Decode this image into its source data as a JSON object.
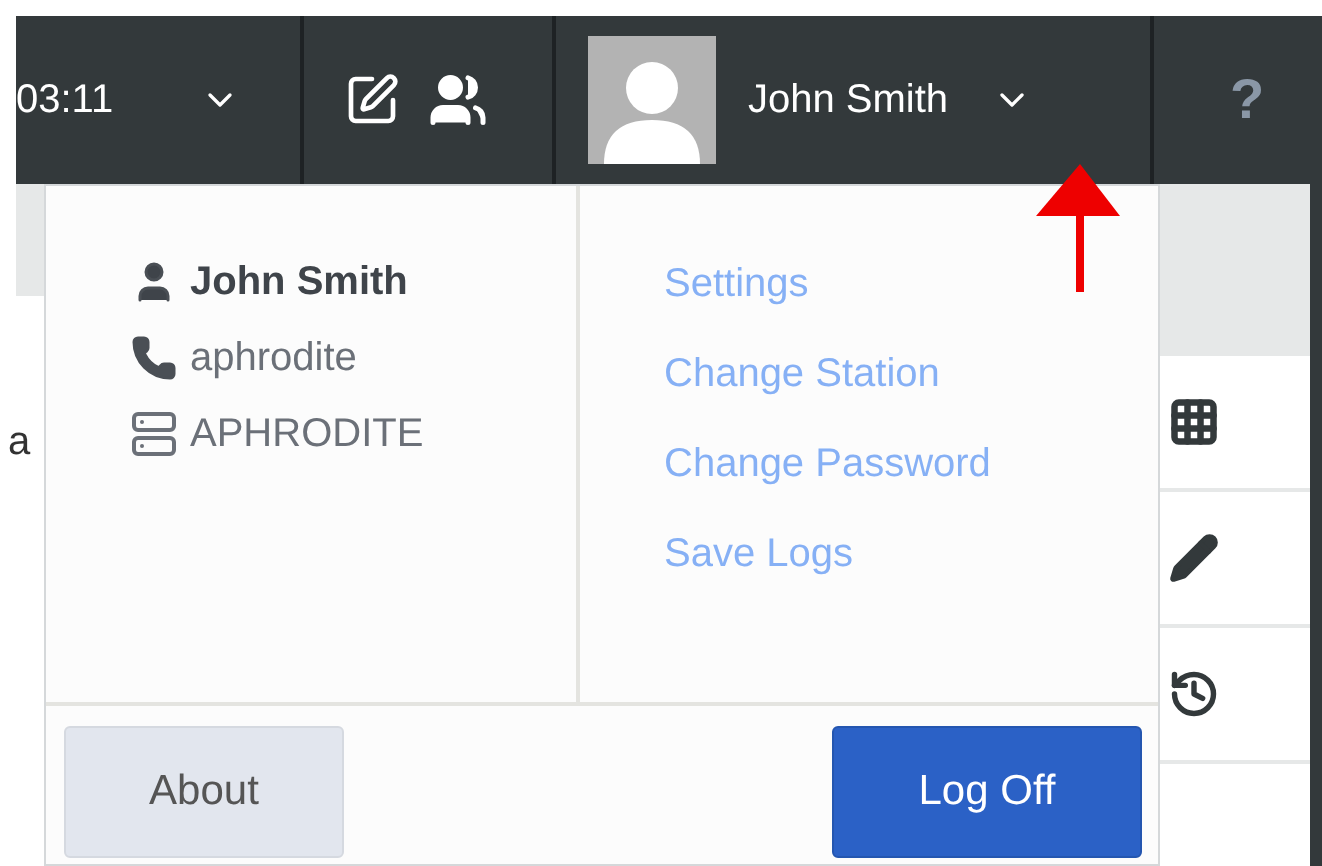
{
  "header": {
    "time": "03:11",
    "user_name": "John Smith",
    "help": "?"
  },
  "background": {
    "cut_text": "a"
  },
  "menu": {
    "info": [
      {
        "kind": "user",
        "text": "John Smith"
      },
      {
        "kind": "phone",
        "text": "aphrodite"
      },
      {
        "kind": "station",
        "text": "APHRODITE"
      }
    ],
    "links": [
      "Settings",
      "Change Station",
      "Change Password",
      "Save Logs"
    ],
    "buttons": [
      {
        "kind": "secondary",
        "label": "About"
      },
      {
        "kind": "primary",
        "label": "Log Off"
      }
    ]
  }
}
